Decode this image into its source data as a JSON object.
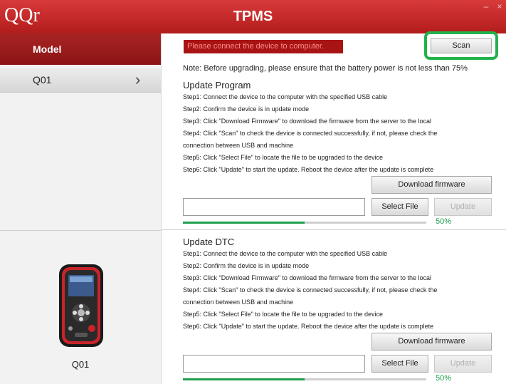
{
  "app": {
    "logo": "QQr",
    "title": "TPMS",
    "minimize": "–",
    "close": "×"
  },
  "sidebar": {
    "header": "Model",
    "items": [
      {
        "label": "Q01",
        "chevron": "›"
      }
    ],
    "device_name": "Q01"
  },
  "main": {
    "status": "Please connect the device to computer.",
    "scan_label": "Scan",
    "note": "Note: Before upgrading, please ensure that the battery power is not less than 75%",
    "sections": [
      {
        "title": "Update Program",
        "steps": [
          "Step1: Connect the device to the computer with the specified USB cable",
          "Step2: Confirm the device is in update mode",
          "Step3: Click \"Download Firmware\" to download the firmware from the server to the local",
          "Step4: Click \"Scan\" to check the device is connected successfully, if not, please check the",
          "connection between USB and machine",
          "Step5: Click \"Select File\" to locate the file to be upgraded to the device",
          "Step6: Click \"Update\" to start the update. Reboot the device after the update is complete"
        ],
        "download_label": "Download firmware",
        "select_label": "Select File",
        "update_label": "Update",
        "file_value": "",
        "progress": 0.5,
        "progress_label": "50%"
      },
      {
        "title": "Update DTC",
        "steps": [
          "Step1: Connect the device to the computer with the specified USB cable",
          "Step2: Confirm the device is in update mode",
          "Step3: Click \"Download Firmware\" to download the firmware from the server to the local",
          "Step4: Click \"Scan\" to check the device is connected successfully, if not, please check the",
          "connection between USB and machine",
          "Step5: Click \"Select File\" to locate the file to be upgraded to the device",
          "Step6: Click \"Update\" to start the update. Reboot the device after the update is complete"
        ],
        "download_label": "Download firmware",
        "select_label": "Select File",
        "update_label": "Update",
        "file_value": "",
        "progress": 0.5,
        "progress_label": "50%"
      }
    ]
  },
  "colors": {
    "brand_red": "#b31c1c",
    "status_red": "#a81414",
    "progress_green": "#1e9f4d",
    "highlight_green": "#22b24c"
  }
}
